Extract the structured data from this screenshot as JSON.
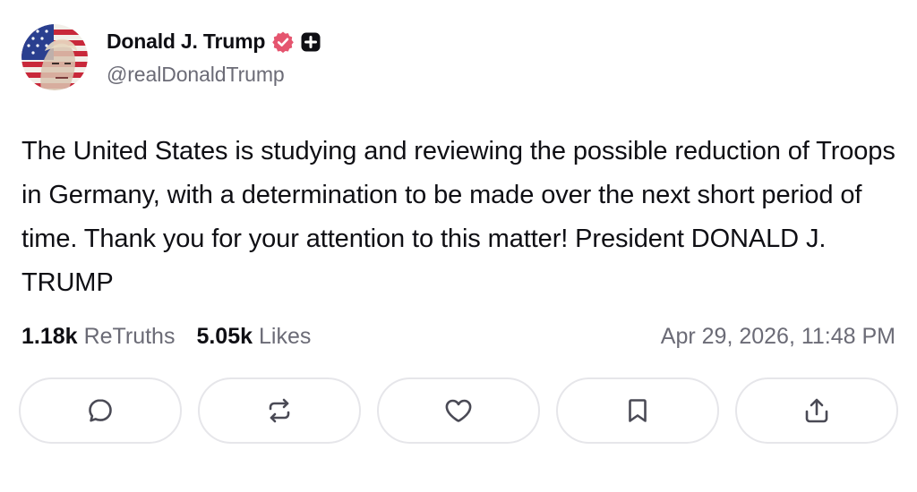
{
  "author": {
    "display_name": "Donald J. Trump",
    "handle": "@realDonaldTrump",
    "avatar_icon": "avatar-flag-portrait",
    "verified_icon": "verified-badge-icon",
    "extra_icon": "plus-badge-icon"
  },
  "post": {
    "text": "The United States is studying and reviewing the possible reduction of Troops in Germany, with a determination to be made over the next short period of time. Thank you for your attention to this matter! President DONALD J. TRUMP"
  },
  "stats": {
    "retruths_count": "1.18k",
    "retruths_label": "ReTruths",
    "likes_count": "5.05k",
    "likes_label": "Likes",
    "timestamp": "Apr 29, 2026, 11:48 PM"
  },
  "actions": [
    {
      "icon": "reply-icon"
    },
    {
      "icon": "retruth-icon"
    },
    {
      "icon": "like-icon"
    },
    {
      "icon": "bookmark-icon"
    },
    {
      "icon": "share-icon"
    }
  ],
  "colors": {
    "text": "#0f0f14",
    "muted": "#6b6b76",
    "verified": "#e5556f",
    "border": "#e6e6ea"
  }
}
